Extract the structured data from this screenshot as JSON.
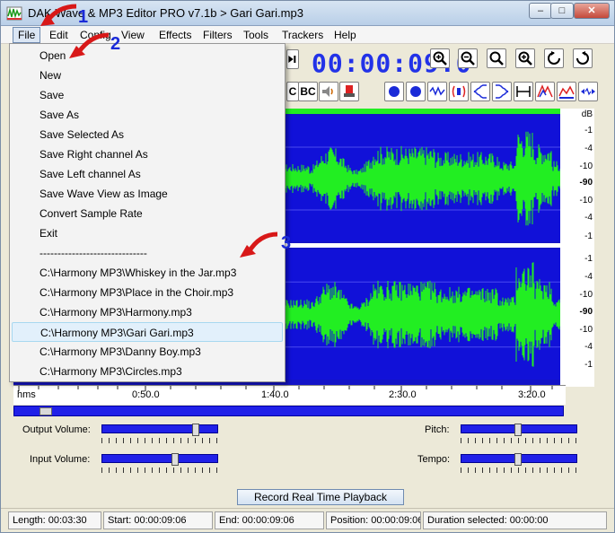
{
  "window": {
    "title": "DAK Wave & MP3 Editor PRO v7.1b > Gari Gari.mp3"
  },
  "menubar": {
    "items": [
      "File",
      "Edit",
      "Config",
      "View",
      "Effects",
      "Filters",
      "Tools",
      "Trackers",
      "Help"
    ]
  },
  "toolbar": {
    "timecode": "00:00:09.0",
    "bc_label_1": "C",
    "bc_label_2": "BC"
  },
  "db_scale": {
    "unit": "dB",
    "labels_top": [
      "-1",
      "-4",
      "-10",
      "-90",
      "-10",
      "-4",
      "-1"
    ],
    "labels_bottom": [
      "-1",
      "-4",
      "-10",
      "-90",
      "-10",
      "-4",
      "-1"
    ]
  },
  "ruler": {
    "unit": "hms",
    "ticks": [
      "0:50.0",
      "1:40.0",
      "2:30.0",
      "3:20.0"
    ]
  },
  "controls": {
    "output_volume": "Output Volume:",
    "input_volume": "Input Volume:",
    "pitch": "Pitch:",
    "tempo": "Tempo:",
    "output_volume_level": 0.85,
    "input_volume_level": 0.65,
    "pitch_level": 0.5,
    "tempo_level": 0.5,
    "record_button": "Record Real Time Playback"
  },
  "status": {
    "length": "Length: 00:03:30",
    "start": "Start: 00:00:09:06",
    "end": "End: 00:00:09:06",
    "position": "Position: 00:00:09:06",
    "duration": "Duration selected: 00:00:00"
  },
  "file_menu": {
    "items": [
      "Open",
      "New",
      "Save",
      "Save As",
      "Save Selected As",
      "Save Right channel As",
      "Save Left channel As",
      "Save Wave View as Image",
      "Convert Sample Rate",
      "Exit",
      "------------------------------",
      "C:\\Harmony MP3\\Whiskey in the Jar.mp3",
      "C:\\Harmony MP3\\Place in the Choir.mp3",
      "C:\\Harmony MP3\\Harmony.mp3",
      "C:\\Harmony MP3\\Gari Gari.mp3",
      "C:\\Harmony MP3\\Danny Boy.mp3",
      "C:\\Harmony MP3\\Circles.mp3"
    ]
  },
  "annotations": [
    "1",
    "2",
    "3"
  ],
  "colors": {
    "wave_bg": "#1111d8",
    "wave_fg": "#22ee22",
    "accent": "#2232e8",
    "arrow": "#d81818"
  }
}
